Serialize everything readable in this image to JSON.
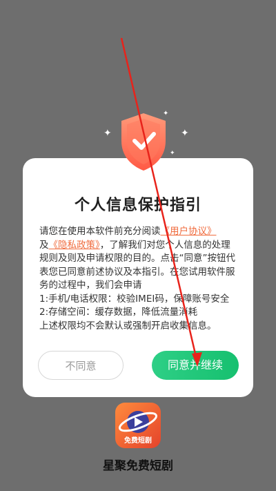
{
  "dialog": {
    "title": "个人信息保护指引",
    "intro": "请您在使用本软件前充分阅读",
    "link_user_agreement": "《用户协议》",
    "and": "及",
    "link_privacy_policy": "《隐私政策》",
    "intro_rest": "，了解我们对您个人信息的处理规则及则及申请权限的目的。点击“同意”按钮代表您已同意前述协议及本指引。在您试用软件服务的过程中，我们会申请",
    "perm_1": "1:手机/电话权限：校验IMEI码，保障账号安全",
    "perm_2": "2:存储空间：缓存数据，降低流量消耗",
    "note": "上述权限均不会默认或强制开启收集信息。",
    "decline_label": "不同意",
    "agree_label": "同意并继续"
  },
  "app": {
    "icon_caption": "免费短剧",
    "name": "星聚免费短剧"
  },
  "colors": {
    "accent_link": "#f06b3d",
    "agree_green": "#16c06f",
    "shield_red": "#ff6a4f"
  },
  "icons": [
    "shield-check-icon",
    "sparkle-icon",
    "play-icon",
    "planet-ring-icon"
  ]
}
